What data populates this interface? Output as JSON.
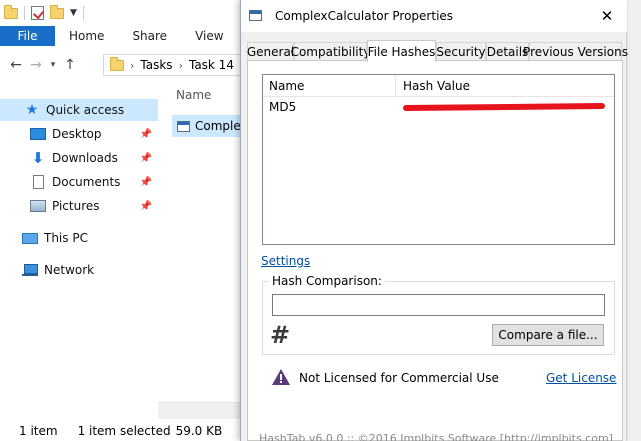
{
  "explorer": {
    "ribbon_tabs": [
      "File",
      "Home",
      "Share",
      "View"
    ],
    "breadcrumb": [
      "Tasks",
      "Task 14"
    ],
    "nav": {
      "quick_access": "Quick access",
      "desktop": "Desktop",
      "downloads": "Downloads",
      "documents": "Documents",
      "pictures": "Pictures",
      "this_pc": "This PC",
      "network": "Network"
    },
    "column_name": "Name",
    "file_name": "ComplexCalculator",
    "status": {
      "count": "1 item",
      "selected": "1 item selected",
      "size": "59.0 KB"
    }
  },
  "dialog": {
    "title": "ComplexCalculator Properties",
    "tabs": [
      "General",
      "Compatibility",
      "File Hashes",
      "Security",
      "Details",
      "Previous Versions"
    ],
    "active_tab": "File Hashes",
    "hash_table": {
      "col_name": "Name",
      "col_value": "Hash Value",
      "rows": [
        {
          "name": "MD5",
          "value_redacted": true
        }
      ]
    },
    "settings_link": "Settings",
    "comparison": {
      "label": "Hash Comparison:",
      "input_value": "",
      "compare_button": "Compare a file..."
    },
    "license": {
      "text": "Not Licensed for Commercial Use",
      "link": "Get License"
    },
    "footer": "HashTab v6.0.0 :: ©2016 Implbits Software [http://implbits.com]",
    "icons": {
      "warning": "warning-triangle-icon",
      "hash": "hash-icon",
      "close": "close-icon"
    },
    "colors": {
      "redaction": "#e8141c",
      "link": "#0050a0",
      "file_tab": "#1a6dc7"
    }
  }
}
